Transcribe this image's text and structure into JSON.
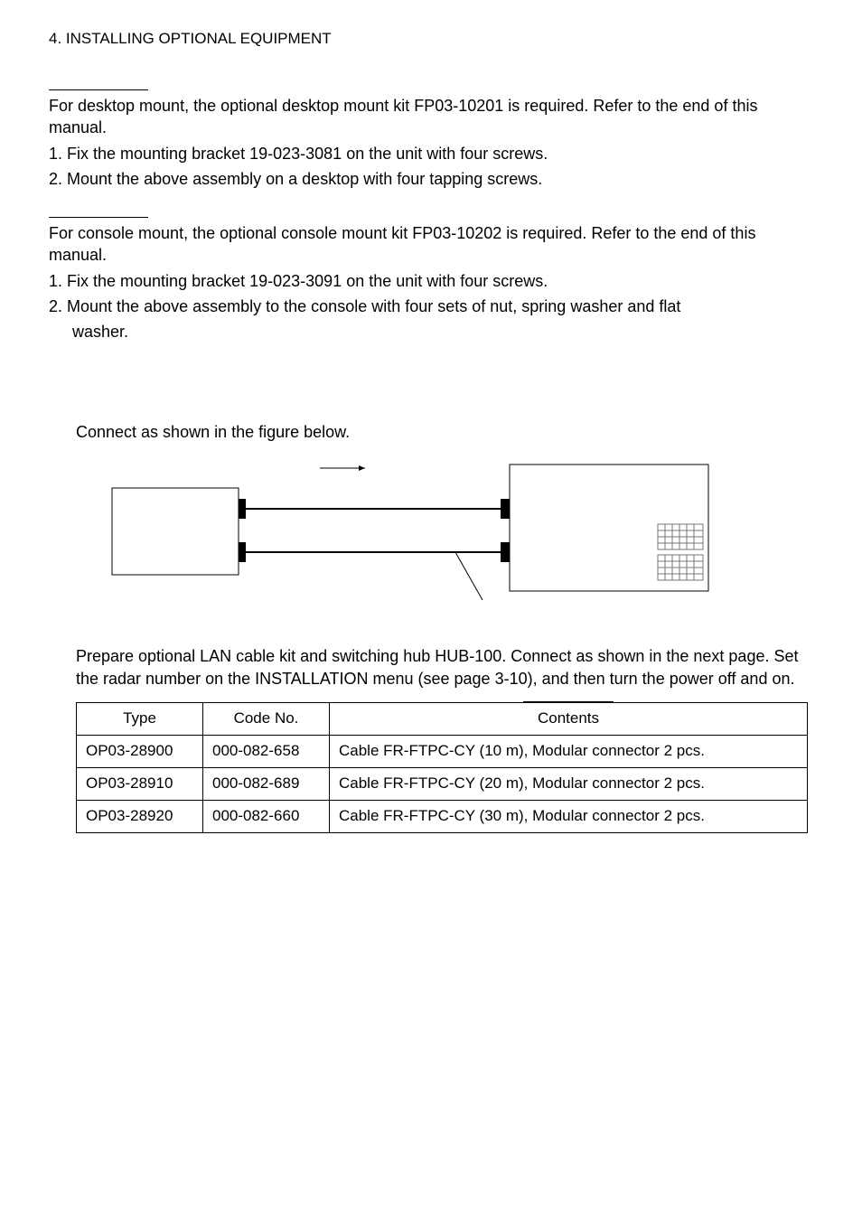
{
  "header": "4. INSTALLING OPTIONAL EQUIPMENT",
  "sectionA": {
    "intro": "For desktop mount, the optional desktop mount kit FP03-10201 is required. Refer to the end of this manual.",
    "step1": "1. Fix the mounting bracket 19-023-3081 on the unit with four screws.",
    "step2": "2. Mount the above assembly on a desktop with four tapping screws."
  },
  "sectionB": {
    "intro": "For console mount, the optional console mount kit FP03-10202 is required. Refer to the end of this manual.",
    "step1": "1. Fix the mounting bracket 19-023-3091 on the unit with four screws.",
    "step2a": "2. Mount the above assembly to the console with four sets of nut, spring washer and flat",
    "step2b": "washer."
  },
  "sectionC": {
    "text": "Connect as shown in the figure below."
  },
  "sectionD": {
    "text": "Prepare optional LAN cable kit and switching hub HUB-100. Connect as shown in the next page. Set the radar number on the INSTALLATION menu (see page 3-10), and then turn the power off and on."
  },
  "table": {
    "headers": {
      "type": "Type",
      "code": "Code No.",
      "contents": "Contents"
    },
    "rows": [
      {
        "type": "OP03-28900",
        "code": "000-082-658",
        "contents": "Cable FR-FTPC-CY (10 m), Modular connector 2 pcs."
      },
      {
        "type": "OP03-28910",
        "code": "000-082-689",
        "contents": "Cable FR-FTPC-CY (20 m), Modular connector 2 pcs."
      },
      {
        "type": "OP03-28920",
        "code": "000-082-660",
        "contents": "Cable FR-FTPC-CY (30 m), Modular connector 2 pcs."
      }
    ]
  }
}
